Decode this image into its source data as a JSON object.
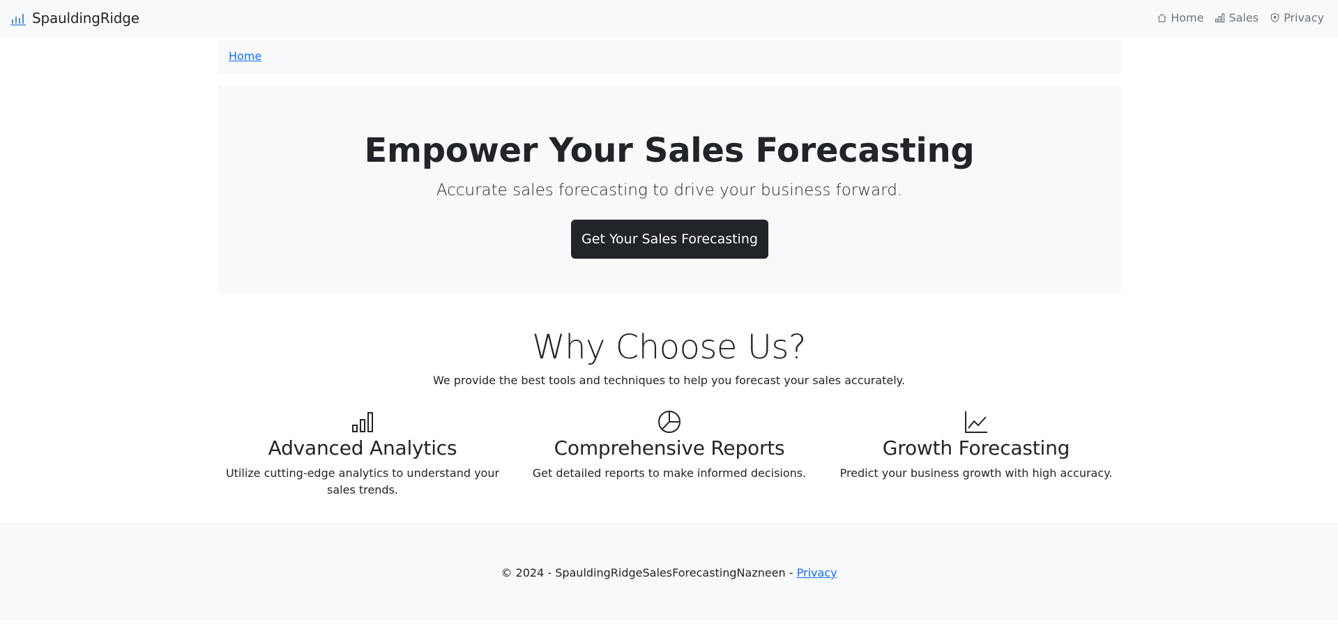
{
  "navbar": {
    "brand": "SpauldingRidge",
    "items": [
      {
        "label": "Home",
        "icon": "house-icon"
      },
      {
        "label": "Sales",
        "icon": "bar-chart-icon"
      },
      {
        "label": "Privacy",
        "icon": "shield-icon"
      }
    ]
  },
  "breadcrumb": {
    "home": "Home"
  },
  "hero": {
    "title": "Empower Your Sales Forecasting",
    "lead": "Accurate sales forecasting to drive your business forward.",
    "cta": "Get Your Sales Forecasting"
  },
  "why": {
    "title": "Why Choose Us?",
    "subtitle": "We provide the best tools and techniques to help you forecast your sales accurately.",
    "features": [
      {
        "icon": "bar-chart-icon",
        "title": "Advanced Analytics",
        "text": "Utilize cutting-edge analytics to understand your sales trends."
      },
      {
        "icon": "pie-chart-icon",
        "title": "Comprehensive Reports",
        "text": "Get detailed reports to make informed decisions."
      },
      {
        "icon": "line-chart-icon",
        "title": "Growth Forecasting",
        "text": "Predict your business growth with high accuracy."
      }
    ]
  },
  "footer": {
    "copyright": "© 2024 - SpauldingRidgeSalesForecastingNazneen - ",
    "privacy": "Privacy"
  },
  "colors": {
    "navbar_bg": "#f8f9fa",
    "link": "#0d6efd",
    "dark_button": "#212529",
    "nav_text": "#6c757d"
  }
}
